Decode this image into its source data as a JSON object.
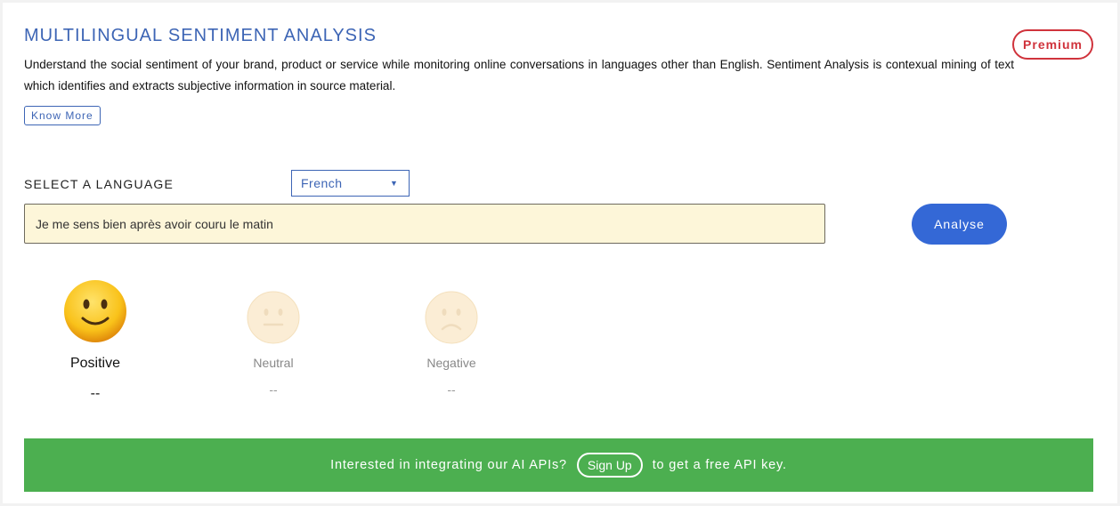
{
  "header": {
    "title": "MULTILINGUAL SENTIMENT ANALYSIS",
    "premium_label": "Premium",
    "description": "Understand the social sentiment of your brand, product or service while monitoring online conversations in languages other than English. Sentiment Analysis is contexual mining of text which identifies and extracts subjective information in source material.",
    "know_more_label": "Know More"
  },
  "form": {
    "language_label": "SELECT A LANGUAGE",
    "language_selected": "French",
    "input_value": "Je me sens bien après avoir couru le matin",
    "analyse_label": "Analyse"
  },
  "results": {
    "positive": {
      "label": "Positive",
      "score": "--",
      "icon": "slightly-smiling-face-icon",
      "active": true
    },
    "neutral": {
      "label": "Neutral",
      "score": "--",
      "icon": "neutral-face-icon",
      "active": false
    },
    "negative": {
      "label": "Negative",
      "score": "--",
      "icon": "frowning-face-icon",
      "active": false
    }
  },
  "banner": {
    "text_before": "Interested in integrating our AI APIs?",
    "signup_label": "Sign Up",
    "text_after": "to get a free API key.",
    "color": "#4caf50"
  },
  "colors": {
    "accent": "#3d65b5",
    "button": "#3468d6",
    "premium": "#d0333c",
    "input_bg": "#fdf6d9"
  }
}
